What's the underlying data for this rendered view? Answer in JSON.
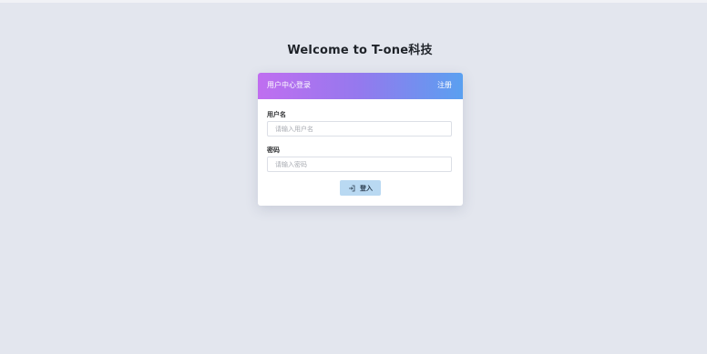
{
  "header": {
    "welcome_text": "Welcome to T-one科技"
  },
  "login_card": {
    "title": "用户中心登录",
    "register_label": "注册",
    "username": {
      "label": "用户名",
      "placeholder": "请输入用户名",
      "value": ""
    },
    "password": {
      "label": "密码",
      "placeholder": "请输入密码",
      "value": ""
    },
    "login_button": {
      "label": "登入",
      "icon": "login-icon"
    }
  },
  "colors": {
    "background": "#e3e6ee",
    "header_gradient_start": "#c06ef0",
    "header_gradient_end": "#5aa0f0",
    "button_background": "#b9d9f2"
  }
}
